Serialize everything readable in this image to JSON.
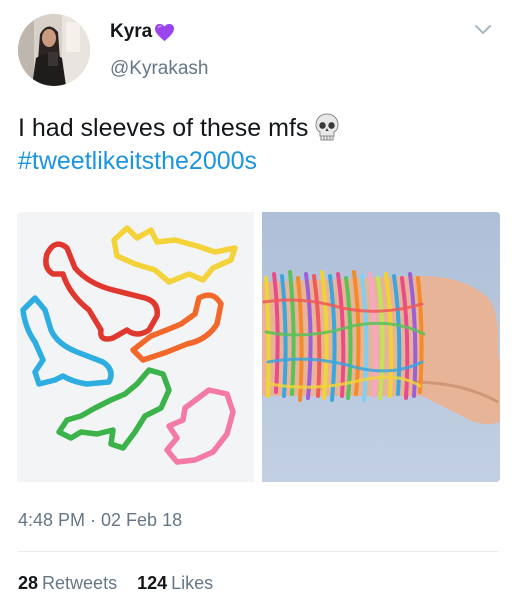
{
  "tweet": {
    "author": {
      "display_name": "Kyra",
      "name_emoji": "purple-heart-icon",
      "handle": "@Kyrakash",
      "avatar": "profile-photo"
    },
    "menu_icon": "chevron-down-icon",
    "text_line1": "I had sleeves of these mfs",
    "text_emoji": "skull-icon",
    "hashtag": "#tweetlikeitsthe2000s",
    "media": [
      {
        "description_icon": "silly-bandz-dinosaur-shapes-photo"
      },
      {
        "description_icon": "silly-bandz-on-wrist-photo"
      }
    ],
    "timestamp": "4:48 PM · 02 Feb 18",
    "stats": {
      "retweets_count": "28",
      "retweets_label": "Retweets",
      "likes_count": "124",
      "likes_label": "Likes"
    }
  },
  "colors": {
    "link": "#1b95e0",
    "secondary_text": "#657786",
    "primary_text": "#14171a",
    "heart": "#9b44f0"
  }
}
